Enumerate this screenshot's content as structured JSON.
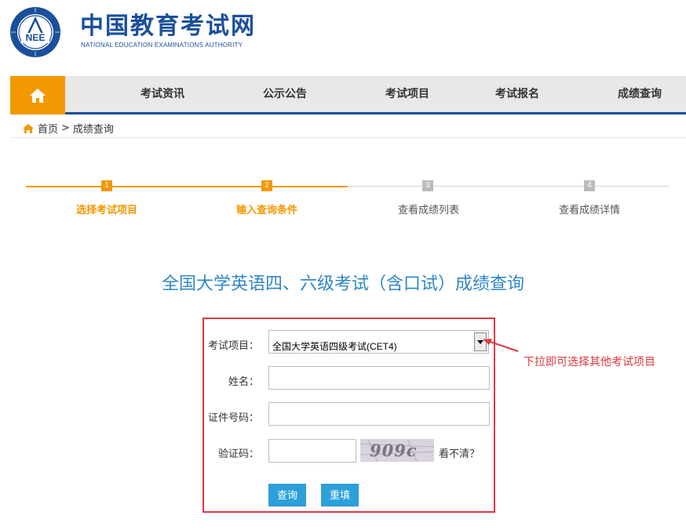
{
  "header": {
    "logo_text": "NEE",
    "site_title": "中国教育考试网",
    "site_subtitle": "NATIONAL EDUCATION EXAMINATIONS AUTHORITY"
  },
  "nav": {
    "items": [
      {
        "label": "考试资讯"
      },
      {
        "label": "公示公告"
      },
      {
        "label": "考试项目"
      },
      {
        "label": "考试报名"
      },
      {
        "label": "成绩查询"
      }
    ]
  },
  "breadcrumb": {
    "home": "首页",
    "sep": ">",
    "current": "成绩查询"
  },
  "steps": [
    {
      "num": "1",
      "label": "选择考试项目",
      "active": true
    },
    {
      "num": "2",
      "label": "输入查询条件",
      "active": true
    },
    {
      "num": "3",
      "label": "查看成绩列表",
      "active": false
    },
    {
      "num": "4",
      "label": "查看成绩详情",
      "active": false
    }
  ],
  "page_title": "全国大学英语四、六级考试（含口试）成绩查询",
  "form": {
    "exam_label": "考试项目：",
    "exam_value": "全国大学英语四级考试(CET4)",
    "name_label": "姓名：",
    "name_value": "",
    "id_label": "证件号码：",
    "id_value": "",
    "code_label": "验证码：",
    "code_value": "",
    "captcha_text": "909c",
    "refresh_text": "看不清？",
    "submit_label": "查询",
    "reset_label": "重填"
  },
  "annotation": "下拉即可选择其他考试项目",
  "colors": {
    "brand_blue": "#1a4f9c",
    "orange": "#f39800",
    "title_blue": "#2f87c8",
    "button_blue": "#2d9fd9",
    "annotation_red": "#e0383e",
    "inactive_gray": "#bbbbbb"
  }
}
